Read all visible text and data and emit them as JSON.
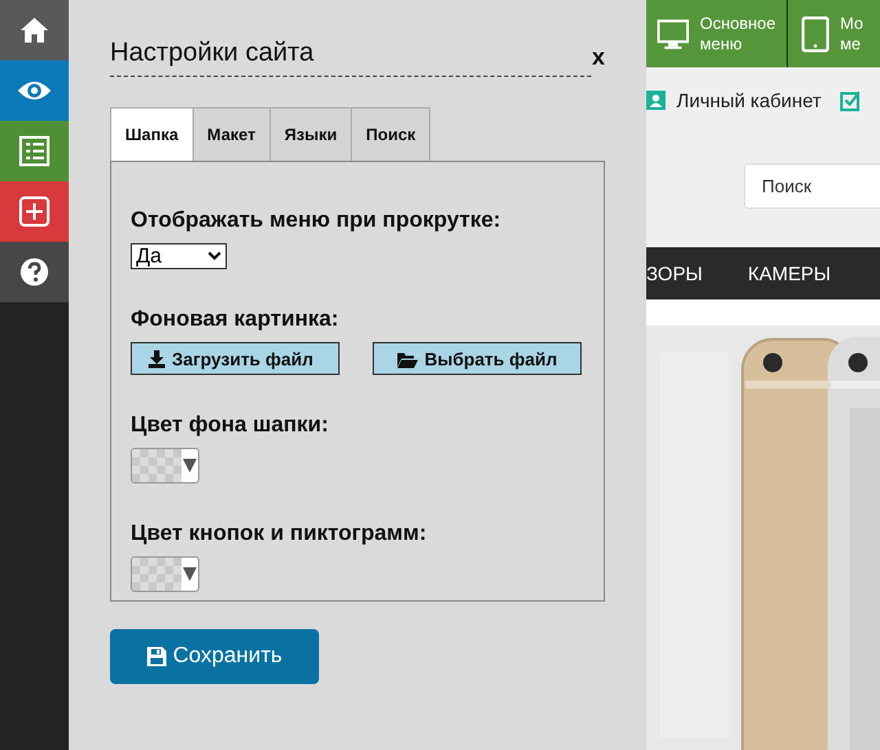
{
  "sidebar": {
    "items": [
      {
        "kind": "home",
        "color": "#595959"
      },
      {
        "kind": "eye",
        "color": "#0a7ab8"
      },
      {
        "kind": "list",
        "color": "#4f8f35"
      },
      {
        "kind": "plus",
        "color": "#d8393c"
      },
      {
        "kind": "help",
        "color": "#474747"
      }
    ]
  },
  "dialog": {
    "title": "Настройки сайта",
    "close": "x",
    "tabs": [
      {
        "label": "Шапка",
        "selected": true
      },
      {
        "label": "Макет",
        "selected": false
      },
      {
        "label": "Языки",
        "selected": false
      },
      {
        "label": "Поиск",
        "selected": false
      }
    ],
    "fields": [
      {
        "kind": "select",
        "label": "Отображать меню при прокрутке:",
        "value": "Да"
      },
      {
        "kind": "upload",
        "label": "Фоновая картинка:",
        "buttons": [
          {
            "kind": "upload",
            "label": "Загрузить файл"
          },
          {
            "kind": "browse",
            "label": "Выбрать файл"
          }
        ]
      },
      {
        "kind": "color",
        "label": "Цвет фона шапки:"
      },
      {
        "kind": "color",
        "label": "Цвет кнопок и пиктограмм:"
      }
    ],
    "save_button": "Сохранить"
  },
  "site": {
    "top_menu": [
      {
        "kind": "monitor",
        "lines": [
          "Основное",
          "меню"
        ]
      },
      {
        "kind": "tablet",
        "lines": [
          "Мо",
          "ме"
        ]
      }
    ],
    "account": "Личный кабинет",
    "search": {
      "placeholder": "Поиск"
    },
    "nav": [
      "ЗОРЫ",
      "КАМЕРЫ"
    ]
  }
}
